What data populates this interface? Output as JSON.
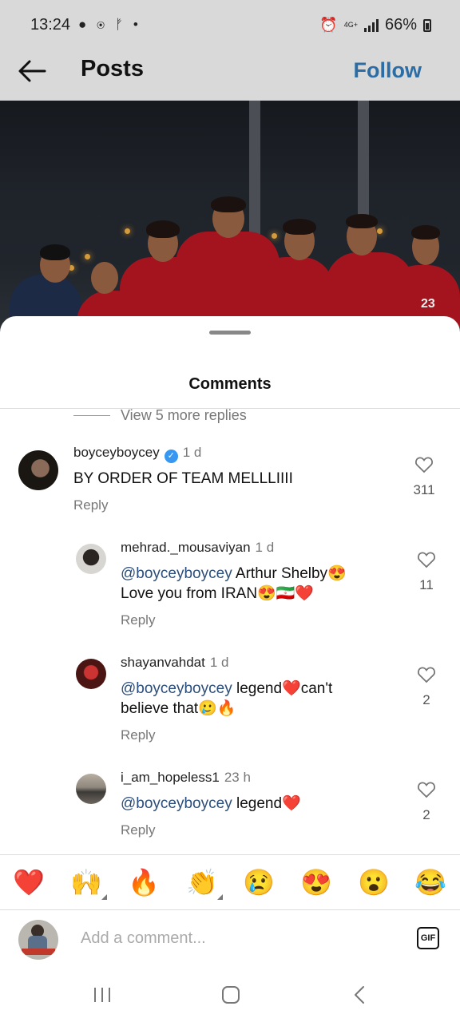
{
  "status_bar": {
    "time": "13:24",
    "network": "4G+",
    "battery": "66%"
  },
  "header": {
    "title": "Posts",
    "follow_label": "Follow"
  },
  "sheet": {
    "title": "Comments",
    "view_more_replies": "View 5 more replies"
  },
  "comments": [
    {
      "username": "boyceyboycey",
      "verified": true,
      "time": "1 d",
      "mention": "",
      "text": "BY ORDER OF TEAM MELLLIIII",
      "reply_label": "Reply",
      "likes": "311"
    },
    {
      "username": "mehrad._mousaviyan",
      "time": "1 d",
      "mention": "@boyceyboycey",
      "text_line1": " Arthur Shelby😍",
      "text_line2": "Love you from IRAN😍🇮🇷❤️",
      "reply_label": "Reply",
      "likes": "11"
    },
    {
      "username": "shayanvahdat",
      "time": "1 d",
      "mention": "@boyceyboycey",
      "text_line1": " legend❤️can't",
      "text_line2": "believe that🥲🔥",
      "reply_label": "Reply",
      "likes": "2"
    },
    {
      "username": "i_am_hopeless1",
      "time": "23 h",
      "mention": "@boyceyboycey",
      "text_line1": " legend❤️",
      "reply_label": "Reply",
      "likes": "2"
    }
  ],
  "reactions": [
    "❤️",
    "🙌",
    "🔥",
    "👏",
    "😢",
    "😍",
    "😮",
    "😂"
  ],
  "composer": {
    "placeholder": "Add a comment...",
    "gif_label": "GIF"
  }
}
